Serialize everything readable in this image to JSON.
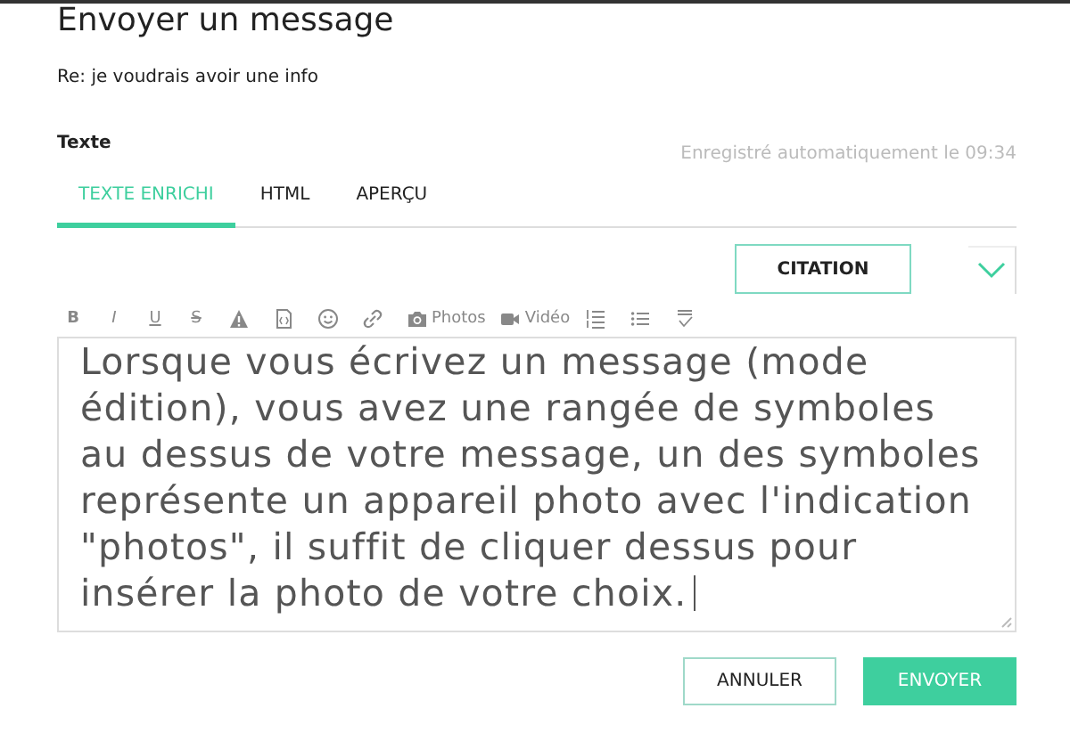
{
  "title": "Envoyer un message",
  "subject": "Re: je voudrais avoir une info",
  "field_label": "Texte",
  "autosave": "Enregistré automatiquement le 09:34",
  "tabs": [
    {
      "label": "TEXTE ENRICHI",
      "selected": true
    },
    {
      "label": "HTML",
      "selected": false
    },
    {
      "label": "APERÇU",
      "selected": false
    }
  ],
  "citation_button": "CITATION",
  "toolbar": [
    {
      "kind": "bold",
      "label": "B"
    },
    {
      "kind": "italic",
      "label": "I"
    },
    {
      "kind": "underline",
      "label": "U"
    },
    {
      "kind": "strike",
      "label": "S"
    },
    {
      "kind": "warning"
    },
    {
      "kind": "code"
    },
    {
      "kind": "emoji"
    },
    {
      "kind": "link"
    },
    {
      "kind": "camera",
      "label": "Photos"
    },
    {
      "kind": "video",
      "label": "Vidéo"
    },
    {
      "kind": "ordered-list"
    },
    {
      "kind": "bullet-list"
    },
    {
      "kind": "spellcheck"
    }
  ],
  "message": "Lorsque vous écrivez un message (mode édition), vous avez une rangée de symboles au dessus de votre message, un des symboles représente un appareil photo avec l'indication \"photos\", il suffit de cliquer dessus pour insérer la photo de votre choix.",
  "buttons": [
    {
      "kind": "secondary",
      "label": "ANNULER"
    },
    {
      "kind": "primary",
      "label": "ENVOYER"
    }
  ]
}
